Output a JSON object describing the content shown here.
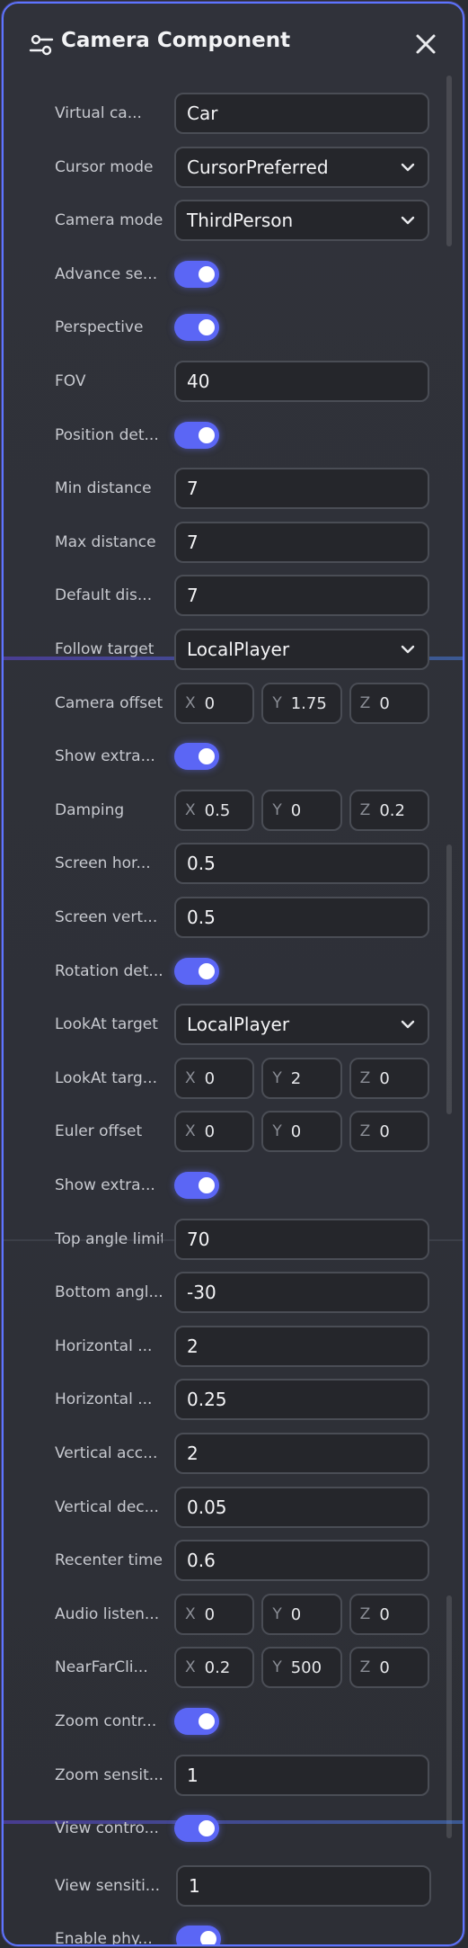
{
  "header": {
    "title": "Camera Component",
    "settings_icon": "sliders-icon",
    "close_icon": "close-icon"
  },
  "colors": {
    "accent": "#5b66f5",
    "panel": "#2d2f36",
    "field": "#25262b",
    "border": "#5d74ff"
  },
  "rows": [
    {
      "type": "input",
      "label": "Virtual ca...",
      "value": "Car"
    },
    {
      "type": "select",
      "label": "Cursor mode",
      "value": "CursorPreferred"
    },
    {
      "type": "select",
      "label": "Camera mode",
      "value": "ThirdPerson"
    },
    {
      "type": "toggle",
      "label": "Advance se...",
      "on": true
    },
    {
      "type": "toggle",
      "label": "Perspective",
      "on": true
    },
    {
      "type": "input",
      "label": "FOV",
      "value": "40"
    },
    {
      "type": "toggle",
      "label": "Position det...",
      "on": true
    },
    {
      "type": "input",
      "label": "Min distance",
      "value": "7"
    },
    {
      "type": "input",
      "label": "Max distance",
      "value": "7"
    },
    {
      "type": "input",
      "label": "Default dis...",
      "value": "7"
    },
    {
      "type": "select",
      "label": "Follow target",
      "value": "LocalPlayer"
    },
    {
      "type": "vec3",
      "label": "Camera offset",
      "x": "0",
      "y": "1.75",
      "z": "0"
    },
    {
      "type": "toggle",
      "label": "Show extra...",
      "on": true
    },
    {
      "type": "vec3",
      "label": "Damping",
      "x": "0.5",
      "y": "0",
      "z": "0.2"
    },
    {
      "type": "input",
      "label": "Screen hor...",
      "value": "0.5"
    },
    {
      "type": "input",
      "label": "Screen vert...",
      "value": "0.5"
    },
    {
      "type": "toggle",
      "label": "Rotation det...",
      "on": true
    },
    {
      "type": "select",
      "label": "LookAt target",
      "value": "LocalPlayer"
    },
    {
      "type": "vec3",
      "label": "LookAt targ...",
      "x": "0",
      "y": "2",
      "z": "0"
    },
    {
      "type": "vec3",
      "label": "Euler offset",
      "x": "0",
      "y": "0",
      "z": "0"
    },
    {
      "type": "toggle",
      "label": "Show extra...",
      "on": true
    },
    {
      "type": "input",
      "label": "Top angle limit",
      "value": "70"
    },
    {
      "type": "input",
      "label": "Bottom angl...",
      "value": "-30"
    },
    {
      "type": "input",
      "label": "Horizontal ...",
      "value": "2"
    },
    {
      "type": "input",
      "label": "Horizontal ...",
      "value": "0.25"
    },
    {
      "type": "input",
      "label": "Vertical acc...",
      "value": "2"
    },
    {
      "type": "input",
      "label": "Vertical dec...",
      "value": "0.05"
    },
    {
      "type": "input",
      "label": "Recenter time",
      "value": "0.6"
    },
    {
      "type": "vec3",
      "label": "Audio listen...",
      "x": "0",
      "y": "0",
      "z": "0"
    },
    {
      "type": "vec3",
      "label": "NearFarCli...",
      "x": "0.2",
      "y": "500",
      "z": "0"
    },
    {
      "type": "toggle",
      "label": "Zoom contr...",
      "on": true
    },
    {
      "type": "input",
      "label": "Zoom sensit...",
      "value": "1"
    },
    {
      "type": "toggle",
      "label": "View contro...",
      "on": true
    },
    {
      "type": "input",
      "label": "View sensiti...",
      "value": "1"
    },
    {
      "type": "toggle",
      "label": "Enable phy...",
      "on": true
    }
  ],
  "axes": {
    "x": "X",
    "y": "Y",
    "z": "Z"
  }
}
